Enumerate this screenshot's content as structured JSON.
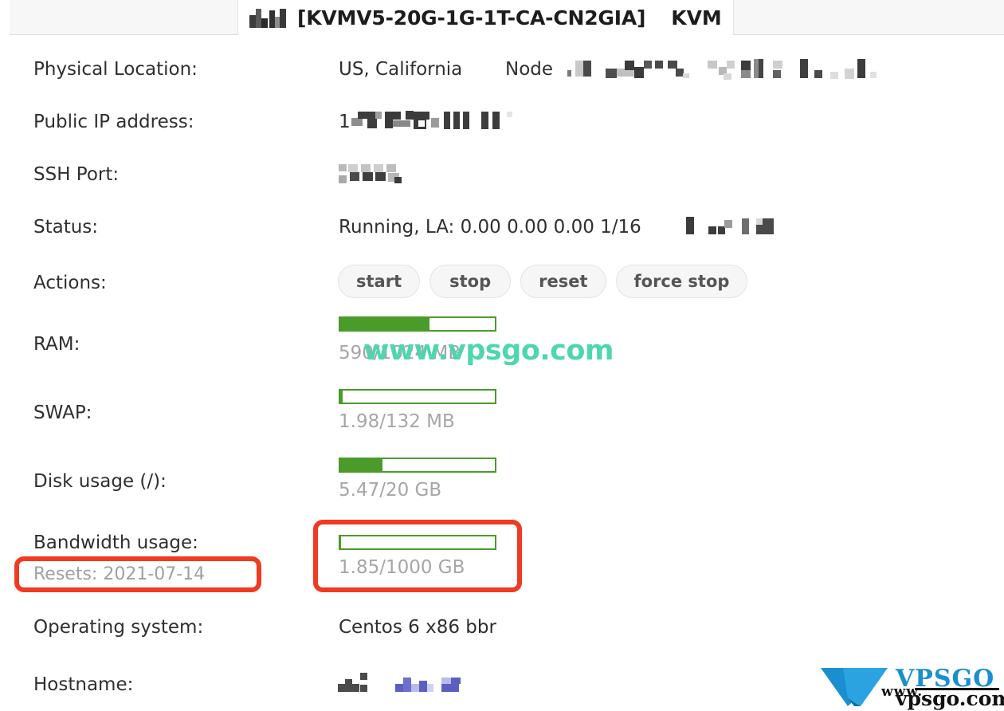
{
  "header": {
    "tab_title": "[KVMV5-20G-1G-1T-CA-CN2GIA]",
    "tab_kind": "KVM",
    "tab_icon": "redacted-mosaic"
  },
  "rows": {
    "physical_location": {
      "label": "Physical Location:",
      "value": "US, California",
      "node_label": "Node",
      "node_value_redacted": true
    },
    "public_ip": {
      "label": "Public IP address:",
      "value": "1",
      "redacted": true
    },
    "ssh_port": {
      "label": "SSH Port:",
      "value": "",
      "redacted": true
    },
    "status": {
      "label": "Status:",
      "value": "Running, LA: 0.00 0.00 0.00 1/16",
      "redacted_tail": true
    },
    "actions": {
      "label": "Actions:",
      "buttons": [
        "start",
        "stop",
        "reset",
        "force stop"
      ]
    },
    "ram": {
      "label": "RAM:",
      "text": "590/1024 MB",
      "percent": 57.6
    },
    "swap": {
      "label": "SWAP:",
      "text": "1.98/132 MB",
      "percent": 1.5
    },
    "disk": {
      "label": "Disk usage (/):",
      "text": "5.47/20 GB",
      "percent": 27.4
    },
    "bandwidth": {
      "label": "Bandwidth usage:",
      "resets_label": "Resets: 2021-07-14",
      "text": "1.85/1000 GB",
      "percent": 0.185
    },
    "operating_system": {
      "label": "Operating system:",
      "value": "Centos 6 x86 bbr"
    },
    "hostname": {
      "label": "Hostname:",
      "value": "",
      "redacted": true
    }
  },
  "watermark": {
    "text": "www.vpsgo.com",
    "color": "#4ed6ae"
  },
  "logo": {
    "brand": "VPSGO",
    "www": "www.",
    "domain": "vpsgo.com",
    "color": "#1a8fd0"
  },
  "annotations": {
    "color": "#ef3b21",
    "boxes": [
      "resets-date",
      "bandwidth-meter"
    ]
  },
  "colors": {
    "meter_green": "#4b9b2a",
    "muted_text": "#a6a6a6"
  }
}
